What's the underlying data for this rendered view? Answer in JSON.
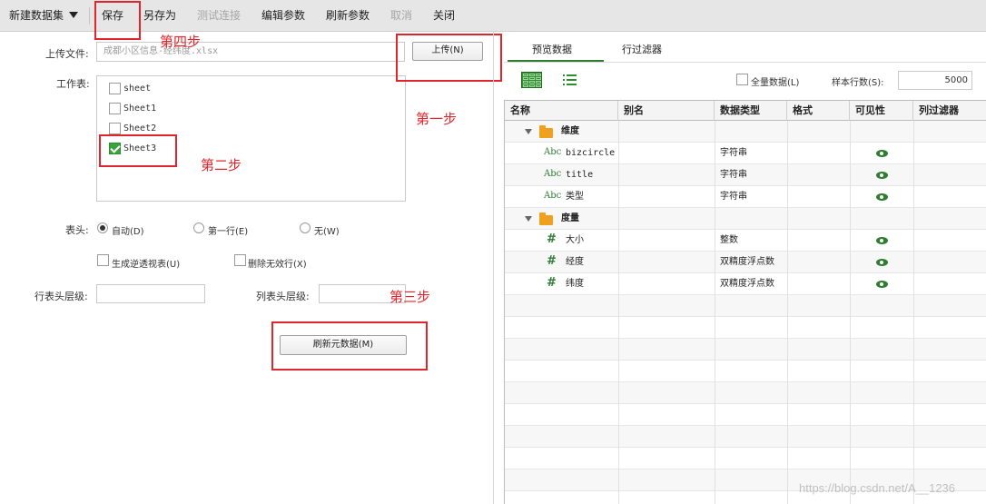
{
  "toolbar": {
    "new_dataset": "新建数据集",
    "save": "保存",
    "save_as": "另存为",
    "test_connection": "测试连接",
    "edit_params": "编辑参数",
    "refresh_params": "刷新参数",
    "cancel": "取消",
    "close": "关闭"
  },
  "left": {
    "upload_label": "上传文件:",
    "upload_value": "成都小区信息-经纬度.xlsx",
    "upload_button": "上传(N)",
    "worksheet_label": "工作表:",
    "sheets": [
      {
        "name": "sheet",
        "checked": false
      },
      {
        "name": "Sheet1",
        "checked": false
      },
      {
        "name": "Sheet2",
        "checked": false
      },
      {
        "name": "Sheet3",
        "checked": true
      }
    ],
    "header_label": "表头:",
    "header_options": [
      "自动(D)",
      "第一行(E)",
      "无(W)"
    ],
    "header_selected": "自动(D)",
    "gen_pivot": "生成逆透视表(U)",
    "delete_invalid_rows": "删除无效行(X)",
    "row_header_level_label": "行表头层级:",
    "col_header_level_label": "列表头层级:",
    "row_header_level_value": "",
    "col_header_level_value": "",
    "refresh_meta_button": "刷新元数据(M)"
  },
  "annotations": {
    "step1": "第一步",
    "step2": "第二步",
    "step3": "第三步",
    "step4": "第四步"
  },
  "right": {
    "tabs": [
      "预览数据",
      "行过滤器"
    ],
    "active_tab": "预览数据",
    "all_data_label": "全量数据(L)",
    "sample_rows_label": "样本行数(S):",
    "sample_rows_value": "5000",
    "columns": [
      "名称",
      "别名",
      "数据类型",
      "格式",
      "可见性",
      "列过滤器"
    ],
    "groups": [
      {
        "name": "维度",
        "fields": [
          {
            "icon": "Abc",
            "name": "bizcircle",
            "type": "字符串",
            "visible": true
          },
          {
            "icon": "Abc",
            "name": "title",
            "type": "字符串",
            "visible": true
          },
          {
            "icon": "Abc",
            "name": "类型",
            "type": "字符串",
            "visible": true
          }
        ]
      },
      {
        "name": "度量",
        "fields": [
          {
            "icon": "#",
            "name": "大小",
            "type": "整数",
            "visible": true
          },
          {
            "icon": "#",
            "name": "经度",
            "type": "双精度浮点数",
            "visible": true
          },
          {
            "icon": "#",
            "name": "纬度",
            "type": "双精度浮点数",
            "visible": true
          }
        ]
      }
    ]
  },
  "watermark": "https://blog.csdn.net/A__1236",
  "colors": {
    "accent_green": "#2e7d32",
    "annotation_red": "#e0262c",
    "toolbar_bg": "#e6e6e6"
  }
}
